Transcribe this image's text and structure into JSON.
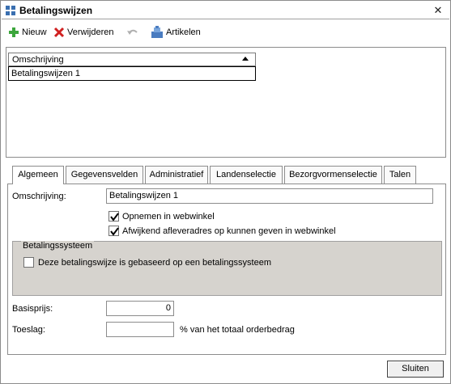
{
  "window": {
    "title": "Betalingswijzen",
    "close_glyph": "✕"
  },
  "toolbar": {
    "new_label": "Nieuw",
    "delete_label": "Verwijderen",
    "articles_label": "Artikelen"
  },
  "list": {
    "column_header": "Omschrijving",
    "rows": [
      {
        "omschrijving": "Betalingswijzen 1"
      }
    ]
  },
  "tabs": [
    {
      "label": "Algemeen",
      "active": true
    },
    {
      "label": "Gegevensvelden",
      "active": false
    },
    {
      "label": "Administratief",
      "active": false
    },
    {
      "label": "Landenselectie",
      "active": false
    },
    {
      "label": "Bezorgvormenselectie",
      "active": false
    },
    {
      "label": "Talen",
      "active": false
    }
  ],
  "form": {
    "description_label": "Omschrijving:",
    "description_value": "Betalingswijzen 1",
    "include_webshop_label": "Opnemen in webwinkel",
    "include_webshop_checked": true,
    "alt_address_label": "Afwijkend afleveradres op kunnen geven in webwinkel",
    "alt_address_checked": true,
    "payment_system_group_title": "Betalingssysteem",
    "payment_system_label": "Deze betalingswijze is gebaseerd op een betalingssysteem",
    "payment_system_checked": false,
    "base_price_label": "Basisprijs:",
    "base_price_value": "0",
    "surcharge_label": "Toeslag:",
    "surcharge_value": "",
    "surcharge_suffix": "% van het totaal orderbedrag"
  },
  "footer": {
    "close_button_label": "Sluiten"
  },
  "icons": {
    "app": "app-grid-icon",
    "new": "plus-icon",
    "delete": "x-icon",
    "undo": "undo-icon",
    "articles": "articles-icon",
    "sort": "sort-ascending-icon"
  },
  "colors": {
    "new_icon": "#3ca63c",
    "delete_icon": "#d02020",
    "articles_icon": "#4a7cc0",
    "group_bg": "#d6d3ce"
  }
}
